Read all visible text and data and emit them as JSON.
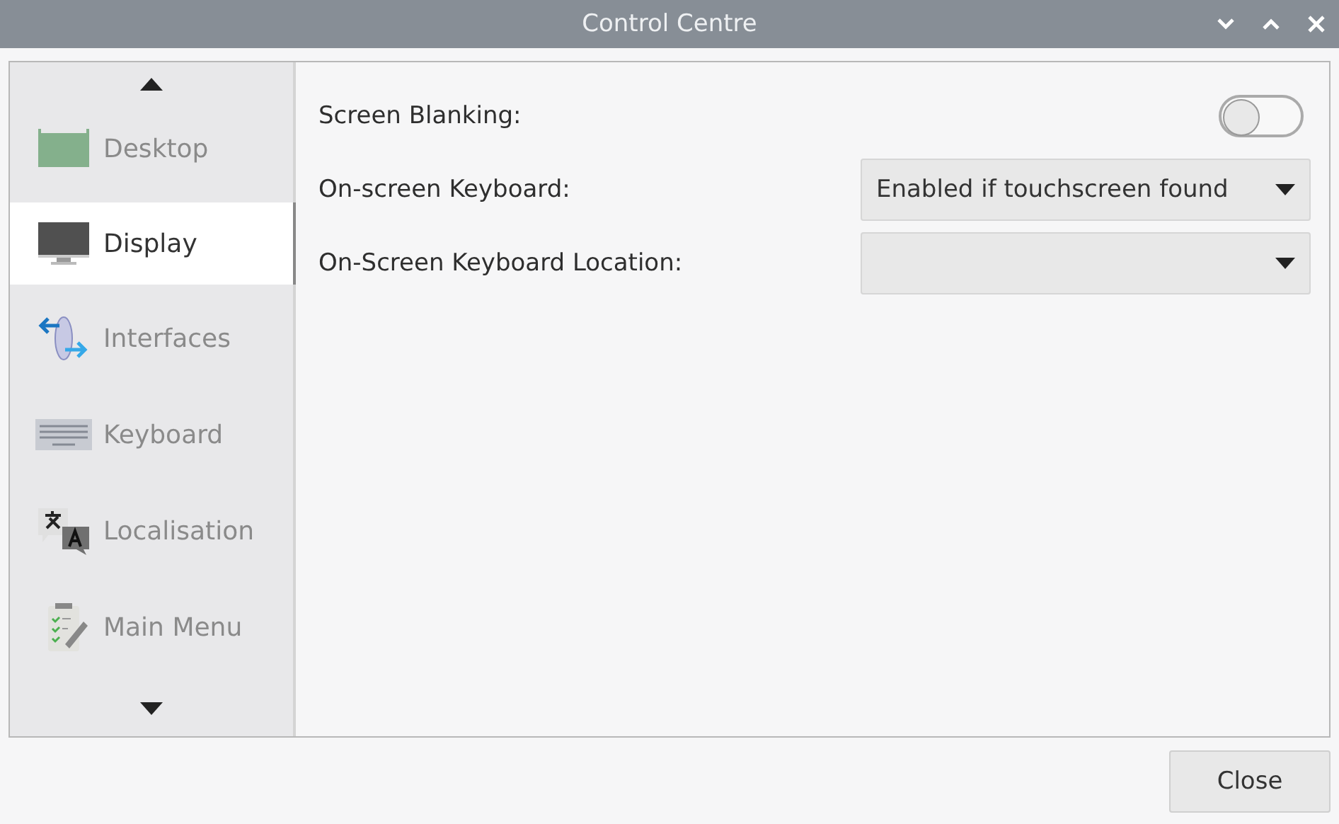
{
  "window": {
    "title": "Control Centre"
  },
  "sidebar": {
    "items": [
      {
        "label": "Desktop",
        "selected": false
      },
      {
        "label": "Display",
        "selected": true
      },
      {
        "label": "Interfaces",
        "selected": false
      },
      {
        "label": "Keyboard",
        "selected": false
      },
      {
        "label": "Localisation",
        "selected": false
      },
      {
        "label": "Main Menu",
        "selected": false
      }
    ]
  },
  "settings": [
    {
      "kind": "toggle",
      "label": "Screen Blanking:",
      "on": false
    },
    {
      "kind": "dropdown",
      "label": "On-screen Keyboard:",
      "value": "Enabled if touchscreen found"
    },
    {
      "kind": "dropdown",
      "label": "On-Screen Keyboard Location:"
    }
  ],
  "buttons": [
    "Close"
  ]
}
